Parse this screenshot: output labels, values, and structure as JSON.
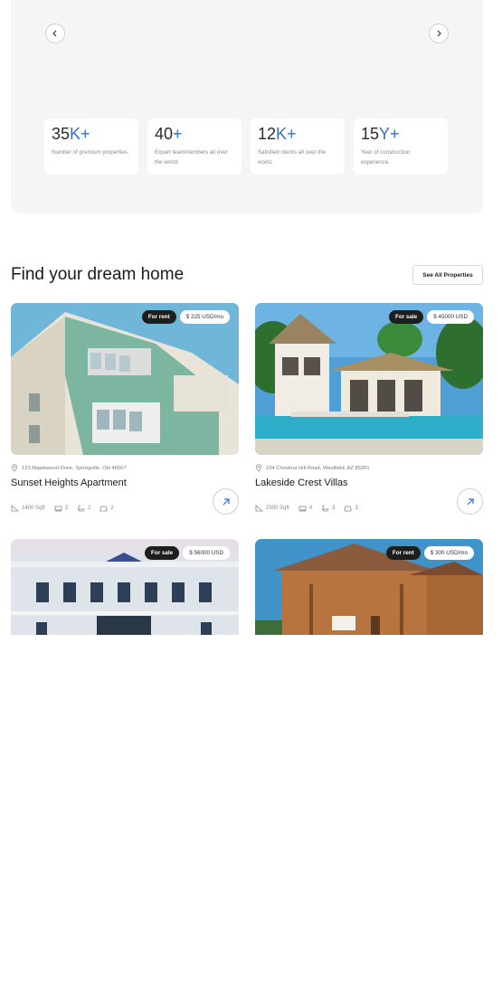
{
  "hero": {
    "prev_icon": "chevron-left-icon",
    "next_icon": "chevron-right-icon",
    "stats": [
      {
        "number": "35",
        "suffix": "K+",
        "desc": "Number of premium properties."
      },
      {
        "number": "40",
        "suffix": "+",
        "desc": "Expart teammembers all over the world."
      },
      {
        "number": "12",
        "suffix": "K+",
        "desc": "Satisfied clients all over the world."
      },
      {
        "number": "15",
        "suffix": "Y+",
        "desc": "Year of construction experience."
      }
    ]
  },
  "listings": {
    "title": "Find your dream home",
    "see_all_label": "See All Properties",
    "cards": [
      {
        "type": "For rent",
        "price": "$ 225 USD/mo",
        "address": "123 Maplewood Drive, Springville, OH 45067",
        "name": "Sunset Heights Apartment",
        "area": "1400 Sqft",
        "beds": "3",
        "baths": "2",
        "garage": "2"
      },
      {
        "type": "For sale",
        "price": "$ 45000 USD",
        "address": "234 Chestnut Hill Road, Westfield, AZ 85301",
        "name": "Lakeside Crest Villas",
        "area": "2300 Sqft",
        "beds": "4",
        "baths": "3",
        "garage": "3"
      },
      {
        "type": "For sale",
        "price": "$ 56000 USD"
      },
      {
        "type": "For rent",
        "price": "$ 300 USD/mo"
      }
    ]
  },
  "colors": {
    "accent": "#2f6fd6",
    "dark_badge": "#1e1e1e",
    "hero_bg": "#f5f5f5"
  }
}
